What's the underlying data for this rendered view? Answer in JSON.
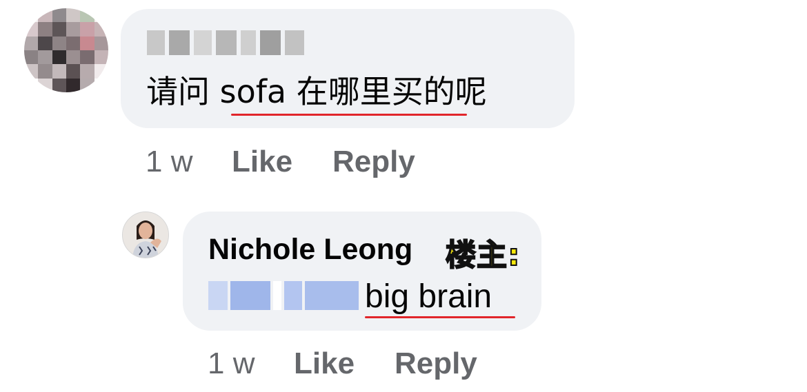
{
  "comments": [
    {
      "text_plain_before": "请问 ",
      "text_underlined": "sofa 在哪里买",
      "text_plain_after": "的呢",
      "meta": {
        "time": "1 w",
        "like": "Like",
        "reply": "Reply"
      }
    },
    {
      "author": "Nichole Leong",
      "op_tag": "楼主:",
      "text": "big brain",
      "meta": {
        "time": "1 w",
        "like": "Like",
        "reply": "Reply"
      }
    }
  ],
  "colors": {
    "bubble": "#f0f2f5",
    "meta_text": "#65676b",
    "underline": "#e1252a",
    "op_tag": "#f6e70c"
  }
}
